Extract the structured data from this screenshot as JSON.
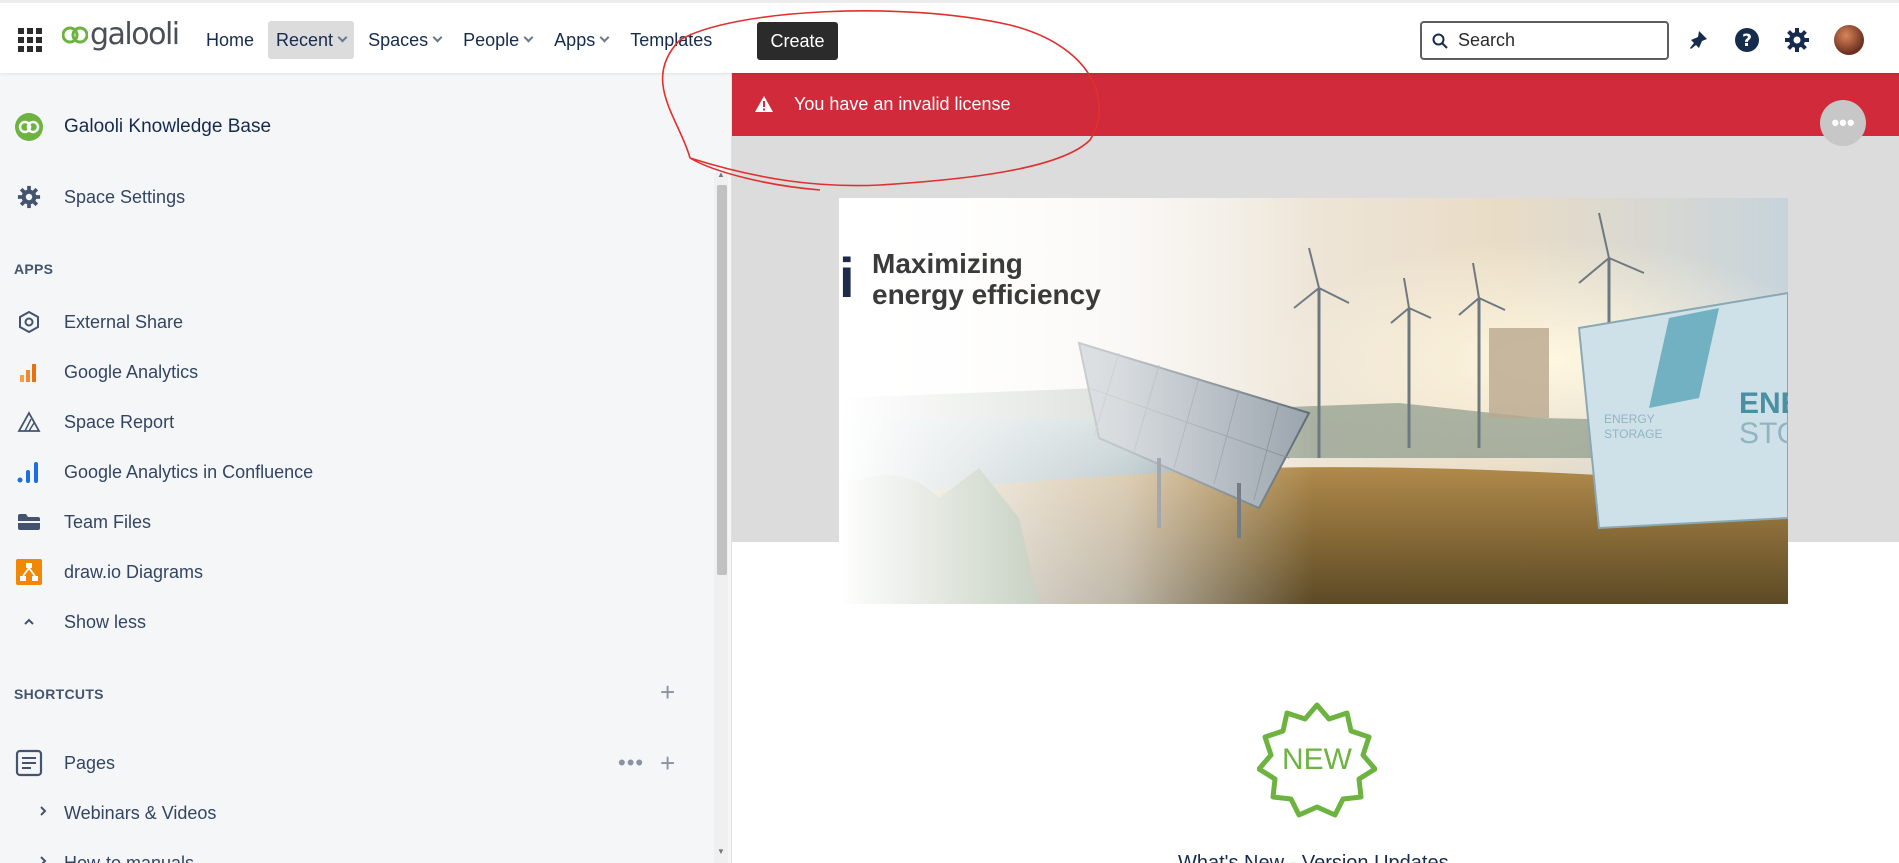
{
  "header": {
    "logo_text": "galooli",
    "nav": [
      {
        "label": "Home",
        "dropdown": false,
        "active": false
      },
      {
        "label": "Recent",
        "dropdown": true,
        "active": true
      },
      {
        "label": "Spaces",
        "dropdown": true,
        "active": false
      },
      {
        "label": "People",
        "dropdown": true,
        "active": false
      },
      {
        "label": "Apps",
        "dropdown": true,
        "active": false
      },
      {
        "label": "Templates",
        "dropdown": false,
        "active": false
      }
    ],
    "create_label": "Create",
    "search_placeholder": "Search",
    "icons": [
      "notifications-icon",
      "help-icon",
      "settings-icon",
      "avatar"
    ]
  },
  "sidebar": {
    "space_name": "Galooli Knowledge Base",
    "space_settings": "Space Settings",
    "apps_heading": "APPS",
    "apps": [
      {
        "label": "External Share",
        "icon": "external-share-icon"
      },
      {
        "label": "Google Analytics",
        "icon": "google-analytics-icon"
      },
      {
        "label": "Space Report",
        "icon": "space-report-icon"
      },
      {
        "label": "Google Analytics in Confluence",
        "icon": "analytics-bars-icon"
      },
      {
        "label": "Team Files",
        "icon": "team-files-icon"
      },
      {
        "label": "draw.io Diagrams",
        "icon": "drawio-icon"
      }
    ],
    "show_less": "Show less",
    "shortcuts_heading": "SHORTCUTS",
    "pages_label": "Pages",
    "tree": [
      "Webinars & Videos",
      "How-to manuals"
    ]
  },
  "main": {
    "alert_text": "You have an invalid license",
    "hero_i": "i",
    "hero_title": "Maximizing\nenergy efficiency",
    "hero_sign_left": "ENERGY STORAGE",
    "hero_sign_right": "ENER STOR",
    "badge_text": "NEW",
    "section_heading": "What's New - Version Updates"
  },
  "colors": {
    "accent_brand": "#6cb33f",
    "alert": "#d12a3a",
    "create_button": "#2b2b2b",
    "annotation": "#e0302f"
  }
}
